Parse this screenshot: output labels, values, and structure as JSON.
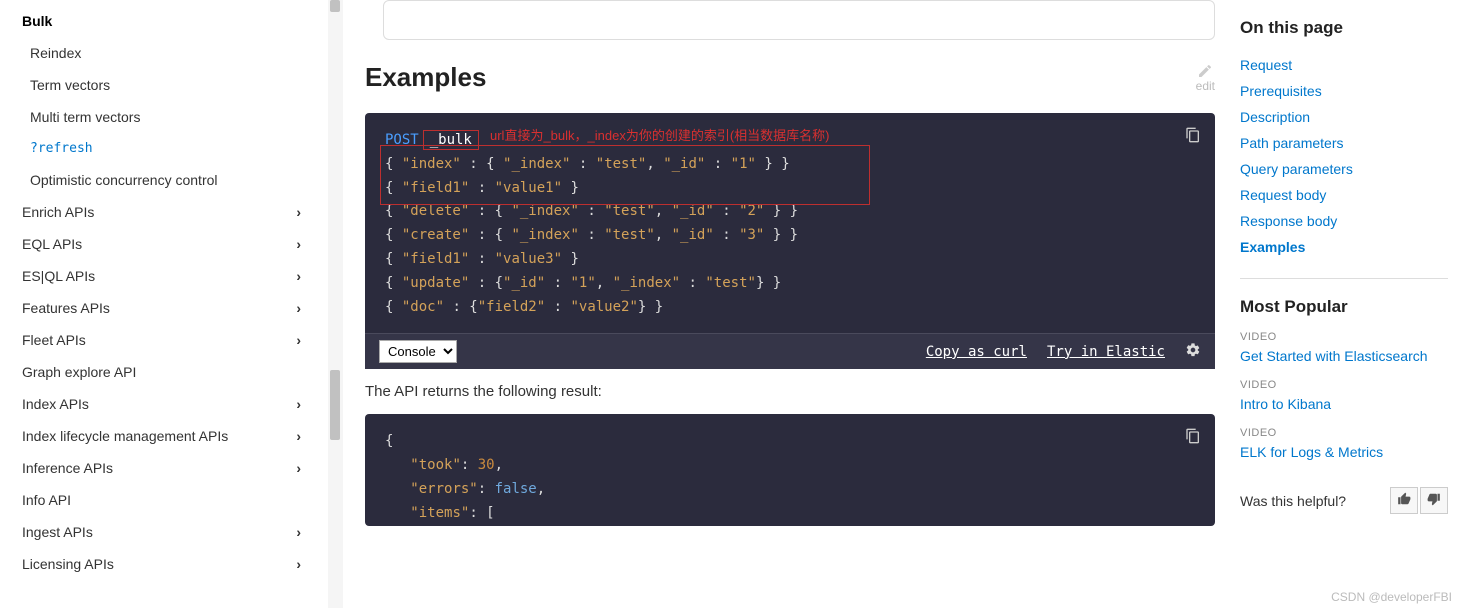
{
  "sidebar": {
    "items": [
      {
        "label": "Bulk",
        "bold": true,
        "sub": false,
        "chev": false
      },
      {
        "label": "Reindex",
        "sub": true
      },
      {
        "label": "Term vectors",
        "sub": true
      },
      {
        "label": "Multi term vectors",
        "sub": true
      },
      {
        "label": "?refresh",
        "sub": true,
        "code": true
      },
      {
        "label": "Optimistic concurrency control",
        "sub": true
      },
      {
        "label": "Enrich APIs",
        "chev": true
      },
      {
        "label": "EQL APIs",
        "chev": true
      },
      {
        "label": "ES|QL APIs",
        "chev": true
      },
      {
        "label": "Features APIs",
        "chev": true
      },
      {
        "label": "Fleet APIs",
        "chev": true
      },
      {
        "label": "Graph explore API"
      },
      {
        "label": "Index APIs",
        "chev": true
      },
      {
        "label": "Index lifecycle management APIs",
        "chev": true
      },
      {
        "label": "Inference APIs",
        "chev": true
      },
      {
        "label": "Info API"
      },
      {
        "label": "Ingest APIs",
        "chev": true
      },
      {
        "label": "Licensing APIs",
        "chev": true
      }
    ]
  },
  "heading": "Examples",
  "edit_label": "edit",
  "annotation": "url直接为_bulk，_index为你的创建的索引(相当数据库名称)",
  "code": {
    "method": "POST",
    "path": "_bulk",
    "lines": [
      "{ \"index\" : { \"_index\" : \"test\", \"_id\" : \"1\" } }",
      "{ \"field1\" : \"value1\" }",
      "{ \"delete\" : { \"_index\" : \"test\", \"_id\" : \"2\" } }",
      "{ \"create\" : { \"_index\" : \"test\", \"_id\" : \"3\" } }",
      "{ \"field1\" : \"value3\" }",
      "{ \"update\" : {\"_id\" : \"1\", \"_index\" : \"test\"} }",
      "{ \"doc\" : {\"field2\" : \"value2\"} }"
    ]
  },
  "toolbar": {
    "select": "Console",
    "copy": "Copy as curl",
    "try": "Try in Elastic"
  },
  "result_intro": "The API returns the following result:",
  "result_code": {
    "lines": [
      {
        "indent": 0,
        "text": "{"
      },
      {
        "indent": 1,
        "key": "\"took\"",
        "val": "30",
        "type": "num",
        "comma": true
      },
      {
        "indent": 1,
        "key": "\"errors\"",
        "val": "false",
        "type": "bool",
        "comma": true
      },
      {
        "indent": 1,
        "key": "\"items\"",
        "val": "[",
        "type": "plain"
      }
    ]
  },
  "toc": {
    "title": "On this page",
    "items": [
      {
        "label": "Request"
      },
      {
        "label": "Prerequisites"
      },
      {
        "label": "Description"
      },
      {
        "label": "Path parameters"
      },
      {
        "label": "Query parameters"
      },
      {
        "label": "Request body"
      },
      {
        "label": "Response body"
      },
      {
        "label": "Examples",
        "active": true
      }
    ]
  },
  "popular": {
    "title": "Most Popular",
    "video_label": "VIDEO",
    "items": [
      "Get Started with Elasticsearch",
      "Intro to Kibana",
      "ELK for Logs & Metrics"
    ]
  },
  "helpful": "Was this helpful?",
  "watermark": "CSDN @developerFBI"
}
